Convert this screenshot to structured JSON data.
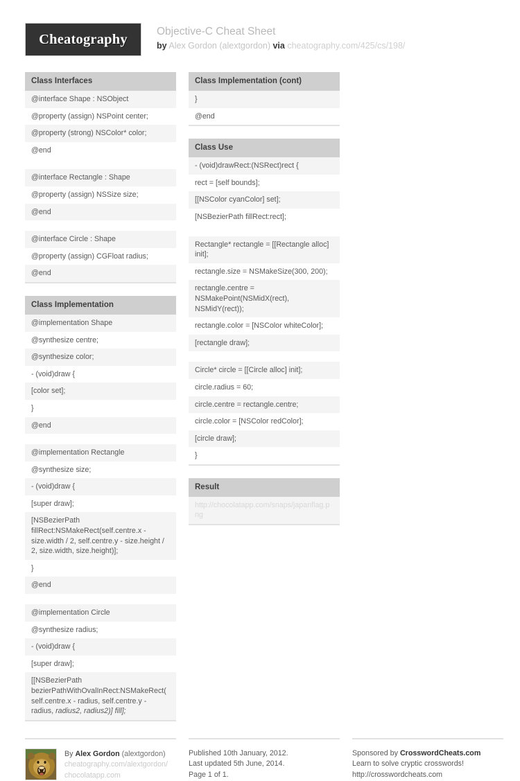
{
  "header": {
    "logo": "Cheatography",
    "title": "Objective-C Cheat Sheet",
    "by_label": "by",
    "author": "Alex Gordon (alextgordon)",
    "via_label": "via",
    "url": "cheatography.com/425/cs/198/"
  },
  "left_column": [
    {
      "title": "Class Interfaces",
      "rows": [
        "@interface Shape : NSObject",
        "@property (assign) NSPoint center;",
        "@property (strong) NSColor* color;",
        "@end",
        "",
        "@interface Rectangle : Shape",
        "@property (assign) NSSize size;",
        "@end",
        "",
        "@interface Circle : Shape",
        "@property (assign) CGFloat radius;",
        "@end"
      ]
    },
    {
      "title": "Class Implementation",
      "rows": [
        "@implementation Shape",
        "@synthesize centre;",
        "@synthesize color;",
        "- (void)draw {",
        "[color set];",
        "}",
        "@end",
        "",
        "@implementation Rectangle",
        "@synthesize size;",
        "- (void)draw {",
        "[super draw];",
        "[NSBezierPath fillRect:NSMakeRect(self.centre.x - size.width / 2, self.centre.y - size.height / 2, size.width, size.height)];",
        "}",
        "@end",
        "",
        "@implementation Circle",
        "@synthesize radius;",
        "- (void)draw {",
        "[super draw];",
        "[[NSBezierPath bezierPathWithOvalInRect:NSMakeRect(self.centre.x - radius, self.centre.y - radius, radius2, radius2)] fill];"
      ]
    }
  ],
  "right_column": [
    {
      "title": "Class Implementation (cont)",
      "rows": [
        "}",
        "@end"
      ]
    },
    {
      "title": "Class Use",
      "rows": [
        "- (void)drawRect:(NSRect)rect {",
        "rect = [self bounds];",
        "[[NSColor cyanColor] set];",
        "[NSBezierPath fillRect:rect];",
        "",
        "Rectangle* rectangle = [[Rectangle alloc] init];",
        "rectangle.size = NSMakeSize(300, 200);",
        "rectangle.centre = NSMakePoint(NSMidX(rect), NSMidY(rect));",
        "rectangle.color = [NSColor whiteColor];",
        "[rectangle draw];",
        "",
        "Circle* circle = [[Circle alloc] init];",
        "circle.radius = 60;",
        "circle.centre = rectangle.centre;",
        "circle.color = [NSColor redColor];",
        "[circle draw];",
        "}"
      ]
    },
    {
      "title": "Result",
      "rows": [
        "http://chocolatapp.com/snaps/japanflag.png"
      ]
    }
  ],
  "footer": {
    "author": {
      "by_label": "By",
      "name": "Alex Gordon",
      "handle": "(alextgordon)",
      "url1": "cheatography.com/alextgordon/",
      "url2": "chocolatapp.com"
    },
    "published": {
      "line1": "Published 10th January, 2012.",
      "line2": "Last updated 5th June, 2014.",
      "line3": "Page 1 of 1."
    },
    "sponsor": {
      "label": "Sponsored by",
      "name": "CrosswordCheats.com",
      "tagline": "Learn to solve cryptic crosswords!",
      "url": "http://crosswordcheats.com"
    }
  },
  "colors": {
    "logo_bg": "#333333",
    "card_header_bg": "#cfcfcf",
    "row_alt_bg": "#f4f4f4",
    "text": "#5a5a5a",
    "muted": "#c4c4c4"
  }
}
